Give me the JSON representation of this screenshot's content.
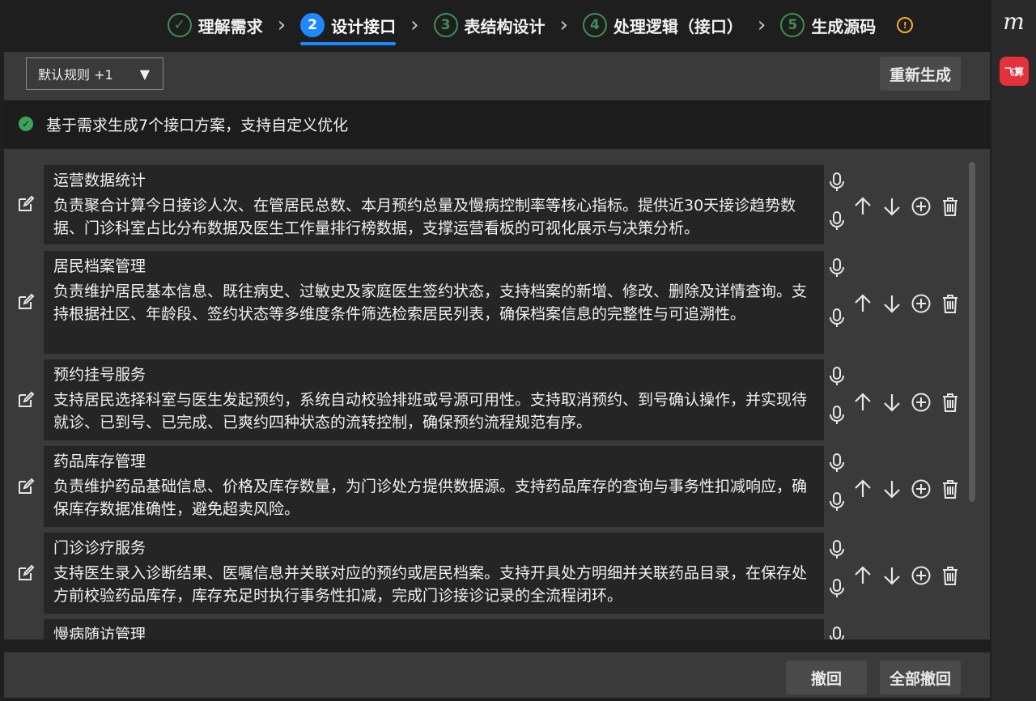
{
  "stepper": {
    "steps": [
      {
        "number": "✓",
        "label": "理解需求",
        "state": "done"
      },
      {
        "number": "2",
        "label": "设计接口",
        "state": "active"
      },
      {
        "number": "3",
        "label": "表结构设计",
        "state": "todo"
      },
      {
        "number": "4",
        "label": "处理逻辑（接口）",
        "state": "todo"
      },
      {
        "number": "5",
        "label": "生成源码",
        "state": "todo"
      }
    ],
    "separator": "›",
    "info_icon": "!"
  },
  "rail": {
    "logo_text": "m",
    "app_label": "飞算"
  },
  "toolbar": {
    "rule_select_value": "默认规则 +1",
    "caret": "▼",
    "regenerate_label": "重新生成"
  },
  "notice": {
    "icon": "✓",
    "text": "基于需求生成7个接口方案，支持自定义优化"
  },
  "items": [
    {
      "title": "运营数据统计",
      "desc": "负责聚合计算今日接诊人次、在管居民总数、本月预约总量及慢病控制率等核心指标。提供近30天接诊趋势数据、门诊科室占比分布数据及医生工作量排行榜数据，支撑运营看板的可视化展示与决策分析。"
    },
    {
      "title": "居民档案管理",
      "desc": "负责维护居民基本信息、既往病史、过敏史及家庭医生签约状态，支持档案的新增、修改、删除及详情查询。支持根据社区、年龄段、签约状态等多维度条件筛选检索居民列表，确保档案信息的完整性与可追溯性。"
    },
    {
      "title": "预约挂号服务",
      "desc": "支持居民选择科室与医生发起预约，系统自动校验排班或号源可用性。支持取消预约、到号确认操作，并实现待就诊、已到号、已完成、已爽约四种状态的流转控制，确保预约流程规范有序。"
    },
    {
      "title": "药品库存管理",
      "desc": "负责维护药品基础信息、价格及库存数量，为门诊处方提供数据源。支持药品库存的查询与事务性扣减响应，确保库存数据准确性，避免超卖风险。"
    },
    {
      "title": "门诊诊疗服务",
      "desc": "支持医生录入诊断结果、医嘱信息并关联对应的预约或居民档案。支持开具处方明细并关联药品目录，在保存处方前校验药品库存，库存充足时执行事务性扣减，完成门诊接诊记录的全流程闭环。"
    },
    {
      "title": "慢病随访管理",
      "desc": ""
    }
  ],
  "footer": {
    "revert_label": "撤回",
    "revert_all_label": "全部撤回"
  },
  "colors": {
    "accent": "#1e88ff",
    "done": "#3f8f54",
    "warning": "#f2b01e",
    "success": "#3aa45a",
    "brand_red": "#e6303b"
  },
  "icons": [
    "edit-icon",
    "microphone-icon",
    "arrow-up-icon",
    "arrow-down-icon",
    "add-circle-icon",
    "trash-icon",
    "info-icon",
    "check-icon",
    "caret-down-icon"
  ]
}
